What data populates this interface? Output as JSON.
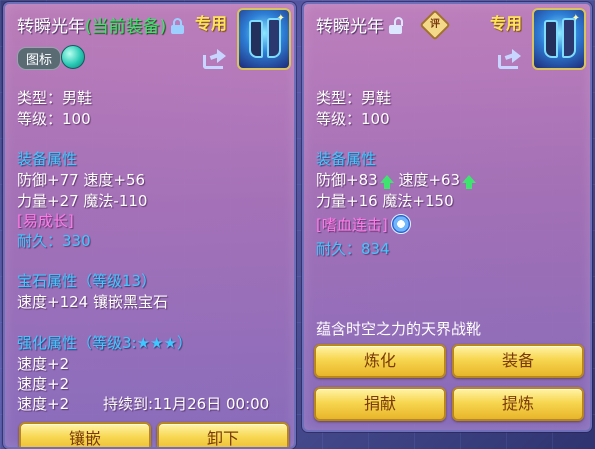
{
  "left_panel": {
    "title": "转瞬光年",
    "status": "(当前装备)",
    "exclusive": "专用",
    "tag": "图标",
    "type_line": "类型：男鞋",
    "level_line": "等级：100",
    "equip_attr_title": "装备属性",
    "attr_line1": "防御+77 速度+56",
    "attr_line2": "力量+27 魔法-110",
    "special": "[易成长]",
    "durability_label": "耐久：",
    "durability_value": "330",
    "gem_title": "宝石属性（等级13）",
    "gem_line": "速度+124 镶嵌黑宝石",
    "enhance_title": "强化属性（等级3:★★★）",
    "enhance_line1": "速度+2",
    "enhance_line2": "速度+2",
    "enhance_line3": "速度+2",
    "enhance_expire": "持续到:11月26日 00:00",
    "buttons": {
      "inlay": "镶嵌",
      "unequip": "卸下"
    }
  },
  "right_panel": {
    "title": "转瞬光年",
    "exclusive": "专用",
    "rating_badge": "评",
    "type_line": "类型：男鞋",
    "level_line": "等级：100",
    "equip_attr_title": "装备属性",
    "attr_defense": "防御+83",
    "attr_speed": "速度+63",
    "attr_line2": "力量+16 魔法+150",
    "special": "[嗜血连击]",
    "durability_label": "耐久：",
    "durability_value": "834",
    "description": "蕴含时空之力的天界战靴",
    "buttons": {
      "refine": "炼化",
      "equip": "装备",
      "donate": "捐献",
      "extract": "提炼"
    }
  },
  "colors": {
    "section": "#3ec8ff",
    "special": "#ff7ae6",
    "current_equip": "#39e66a",
    "exclusive": "#ffe45a",
    "button_gold": "#f7d650",
    "stat_up": "#3fe36f"
  },
  "icons": [
    "lock-icon",
    "unlock-icon",
    "share-icon",
    "gem-icon",
    "rating-icon",
    "up-arrow-icon",
    "refresh-icon",
    "boots-item-icon"
  ]
}
